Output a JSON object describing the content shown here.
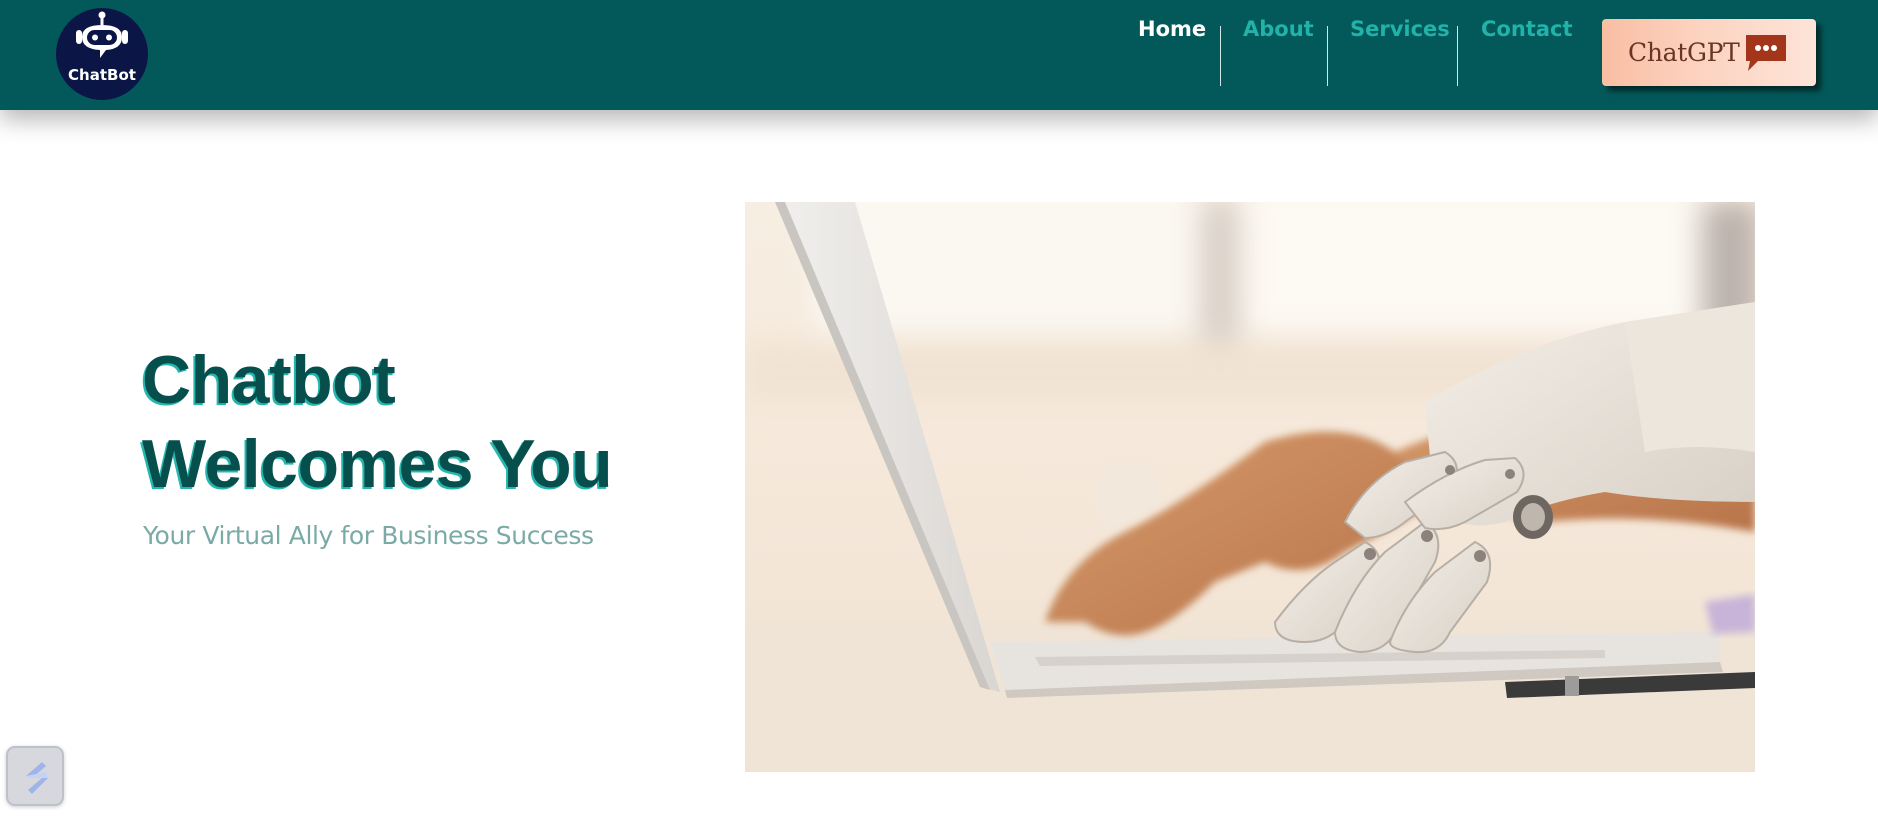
{
  "header": {
    "logo": {
      "text": "ChatBot",
      "icon": "robot-icon"
    },
    "nav": [
      {
        "label": "Home",
        "active": true
      },
      {
        "label": "About",
        "active": false
      },
      {
        "label": "Services",
        "active": false
      },
      {
        "label": "Contact",
        "active": false
      }
    ],
    "cta": {
      "label": "ChatGPT",
      "icon": "chat-bubble-icon"
    }
  },
  "hero": {
    "title_line1": "Chatbot",
    "title_line2": "Welcomes You",
    "subtitle": "Your Virtual Ally for Business Success",
    "image": "robot-hand-typing-laptop-photo"
  },
  "widget": {
    "icon": "lightning-badge-icon"
  },
  "colors": {
    "header_bg": "#03595a",
    "nav_active": "#ffffff",
    "nav_link": "#21b2aa",
    "title": "#064f4d",
    "subtitle": "#7aaaa6",
    "cta_text": "#6a3524",
    "cta_icon": "#a3361a"
  }
}
